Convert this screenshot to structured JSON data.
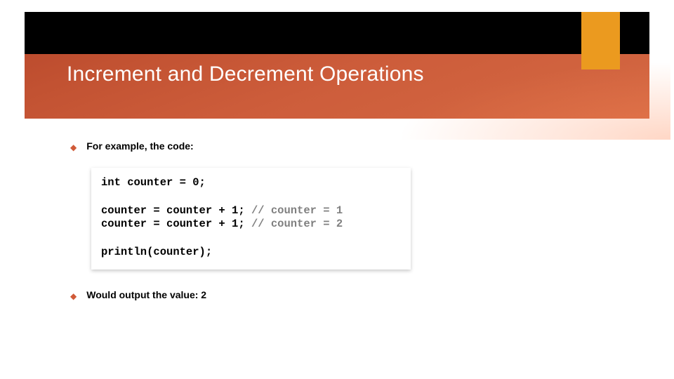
{
  "slide": {
    "title": "Increment and Decrement Operations",
    "bullets": [
      "For example, the code:",
      "Would output the value: 2"
    ],
    "code": {
      "line1_kw": "int",
      "line1_rest": " counter = 0;",
      "line2_body": "counter = counter + 1; ",
      "line2_comment": "// counter = 1",
      "line3_body": "counter = counter + 1; ",
      "line3_comment": "// counter = 2",
      "line4": "println(counter);"
    }
  },
  "colors": {
    "band_gradient_from": "#b7462a",
    "band_gradient_to": "#d46842",
    "accent_orange": "#eb9a1f",
    "bullet": "#d05a38"
  }
}
